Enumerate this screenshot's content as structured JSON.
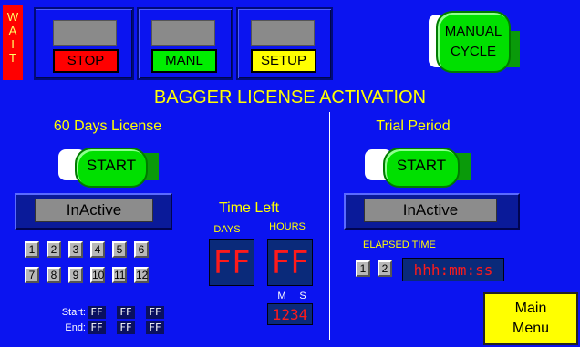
{
  "wait_letters": [
    "W",
    "A",
    "I",
    "T"
  ],
  "modes": {
    "stop_label": "STOP",
    "manl_label": "MANL",
    "setup_label": "SETUP"
  },
  "manual_cycle": {
    "line1": "MANUAL",
    "line2": "CYCLE"
  },
  "title": "BAGGER LICENSE ACTIVATION",
  "license": {
    "heading": "60 Days License",
    "start_label": "START",
    "status": "InActive",
    "month_buttons": [
      "1",
      "2",
      "3",
      "4",
      "5",
      "6",
      "7",
      "8",
      "9",
      "10",
      "11",
      "12"
    ],
    "start_row_label": "Start:",
    "end_row_label": "End:",
    "start_values": [
      "FF",
      "FF",
      "FF"
    ],
    "end_values": [
      "FF",
      "FF",
      "FF"
    ]
  },
  "time_left": {
    "heading": "Time Left",
    "days_label": "DAYS",
    "hours_label": "HOURS",
    "days_value": "FF",
    "hours_value": "FF",
    "m_label": "M",
    "s_label": "S",
    "ms_value": "1234"
  },
  "trial": {
    "heading": "Trial Period",
    "start_label": "START",
    "status": "InActive",
    "elapsed_label": "ELAPSED TIME",
    "buttons": [
      "1",
      "2"
    ],
    "elapsed_value": "hhh:mm:ss"
  },
  "main_menu": {
    "line1": "Main",
    "line2": "Menu"
  },
  "colors": {
    "background": "#0b14f0",
    "title_yellow": "#ffff00",
    "led_red": "#ff1a1a",
    "pill_green": "#00e000"
  }
}
